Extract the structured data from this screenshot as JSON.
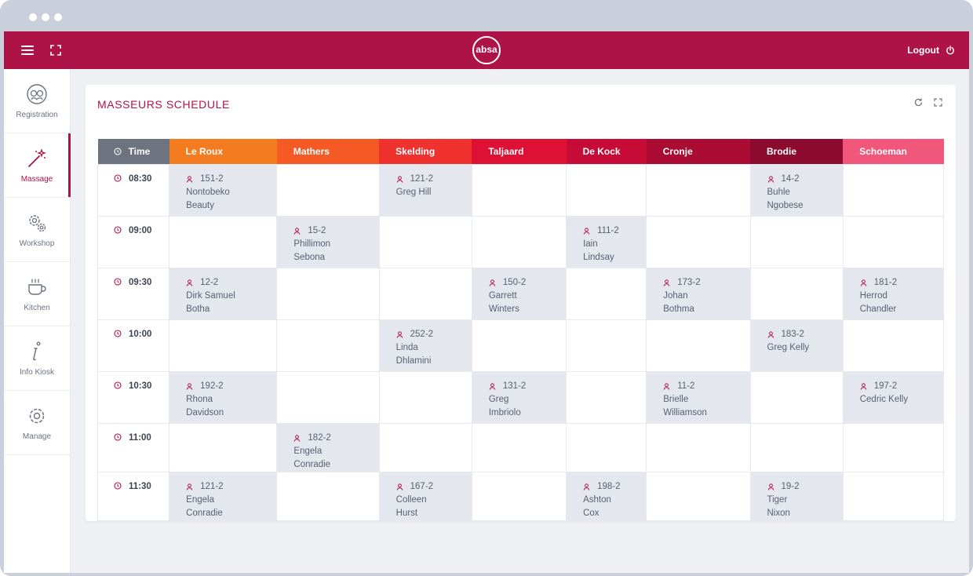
{
  "header": {
    "logo_text": "absa",
    "logout_label": "Logout"
  },
  "sidebar": {
    "items": [
      {
        "label": "Registration",
        "icon": "registration-icon",
        "active": false
      },
      {
        "label": "Massage",
        "icon": "massage-wand-icon",
        "active": true
      },
      {
        "label": "Workshop",
        "icon": "gears-icon",
        "active": false
      },
      {
        "label": "Kitchen",
        "icon": "coffee-cup-icon",
        "active": false
      },
      {
        "label": "Info Kiosk",
        "icon": "info-icon",
        "active": false
      },
      {
        "label": "Manage",
        "icon": "gear-icon",
        "active": false
      }
    ]
  },
  "schedule": {
    "title": "MASSEURS SCHEDULE",
    "time_header": "Time",
    "masseurs": [
      {
        "name": "Le Roux",
        "color": "#f47c20"
      },
      {
        "name": "Mathers",
        "color": "#f55a24"
      },
      {
        "name": "Skelding",
        "color": "#f0322f"
      },
      {
        "name": "Taljaard",
        "color": "#de1034"
      },
      {
        "name": "De Kock",
        "color": "#c60c36"
      },
      {
        "name": "Cronje",
        "color": "#aa0c34"
      },
      {
        "name": "Brodie",
        "color": "#8c0a2e"
      },
      {
        "name": "Schoeman",
        "color": "#f0577a"
      }
    ],
    "rows": [
      {
        "time": "08:30",
        "size": "tall",
        "slots": [
          {
            "id": "151-2",
            "name": "Nontobeko Beauty"
          },
          null,
          {
            "id": "121-2",
            "name": "Greg Hill"
          },
          null,
          null,
          null,
          {
            "id": "14-2",
            "name": "Buhle Ngobese"
          },
          null
        ]
      },
      {
        "time": "09:00",
        "size": "tall",
        "slots": [
          null,
          {
            "id": "15-2",
            "name": "Phillimon Sebona"
          },
          null,
          null,
          {
            "id": "111-2",
            "name": "Iain Lindsay"
          },
          null,
          null,
          null
        ]
      },
      {
        "time": "09:30",
        "size": "tall",
        "slots": [
          {
            "id": "12-2",
            "name": "Dirk Samuel Botha"
          },
          null,
          null,
          {
            "id": "150-2",
            "name": "Garrett Winters"
          },
          null,
          {
            "id": "173-2",
            "name": "Johan Bothma"
          },
          null,
          {
            "id": "181-2",
            "name": "Herrod Chandler"
          }
        ]
      },
      {
        "time": "10:00",
        "size": "tall",
        "slots": [
          null,
          null,
          {
            "id": "252-2",
            "name": "Linda Dhlamini"
          },
          null,
          null,
          null,
          {
            "id": "183-2",
            "name": "Greg Kelly"
          },
          null
        ]
      },
      {
        "time": "10:30",
        "size": "tall",
        "slots": [
          {
            "id": "192-2",
            "name": "Rhona Davidson"
          },
          null,
          null,
          {
            "id": "131-2",
            "name": "Greg Imbriolo"
          },
          null,
          {
            "id": "11-2",
            "name": "Brielle Williamson"
          },
          null,
          {
            "id": "197-2",
            "name": "Cedric Kelly"
          }
        ]
      },
      {
        "time": "11:00",
        "size": "short",
        "slots": [
          null,
          {
            "id": "182-2",
            "name": "Engela Conradie"
          },
          null,
          null,
          null,
          null,
          null,
          null
        ]
      },
      {
        "time": "11:30",
        "size": "short",
        "slots": [
          {
            "id": "121-2",
            "name": "Engela Conradie"
          },
          null,
          {
            "id": "167-2",
            "name": "Colleen Hurst"
          },
          null,
          {
            "id": "198-2",
            "name": "Ashton Cox"
          },
          null,
          {
            "id": "19-2",
            "name": "Tiger Nixon"
          },
          null
        ]
      }
    ]
  }
}
